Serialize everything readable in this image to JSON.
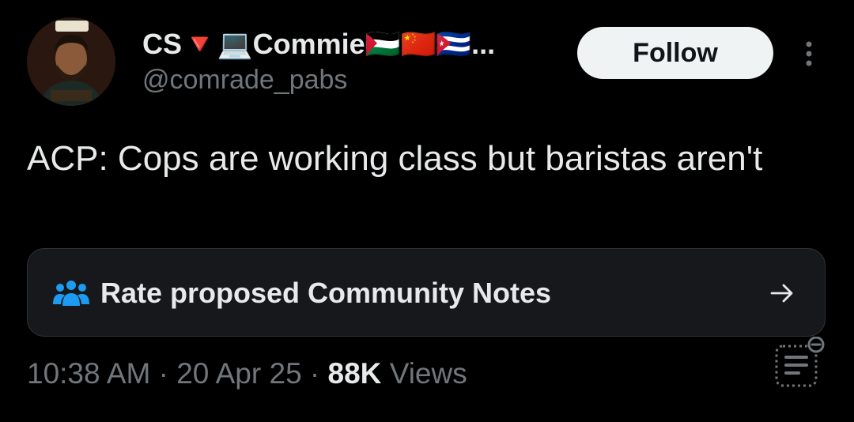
{
  "author": {
    "display_name": "CS🔻💻Commie🇵🇸🇨🇳🇨🇺...",
    "handle": "@comrade_pabs"
  },
  "follow_label": "Follow",
  "tweet": {
    "text": "ACP: Cops are working class but baristas aren't"
  },
  "community_notes": {
    "label": "Rate proposed Community Notes"
  },
  "meta": {
    "time": "10:38 AM",
    "sep1": " · ",
    "date": "20 Apr 25",
    "sep2": " · ",
    "views_count": "88K",
    "views_label": " Views"
  },
  "colors": {
    "background": "#000000",
    "text_primary": "#e7e9ea",
    "text_secondary": "#71767b",
    "card_bg": "#16181c",
    "notes_icon": "#1d9bf0",
    "follow_bg": "#eff3f4"
  },
  "icons": {
    "more": "more-vertical-icon",
    "notes": "community-notes-people-icon",
    "arrow": "arrow-right-icon",
    "analytics": "post-analytics-icon"
  }
}
